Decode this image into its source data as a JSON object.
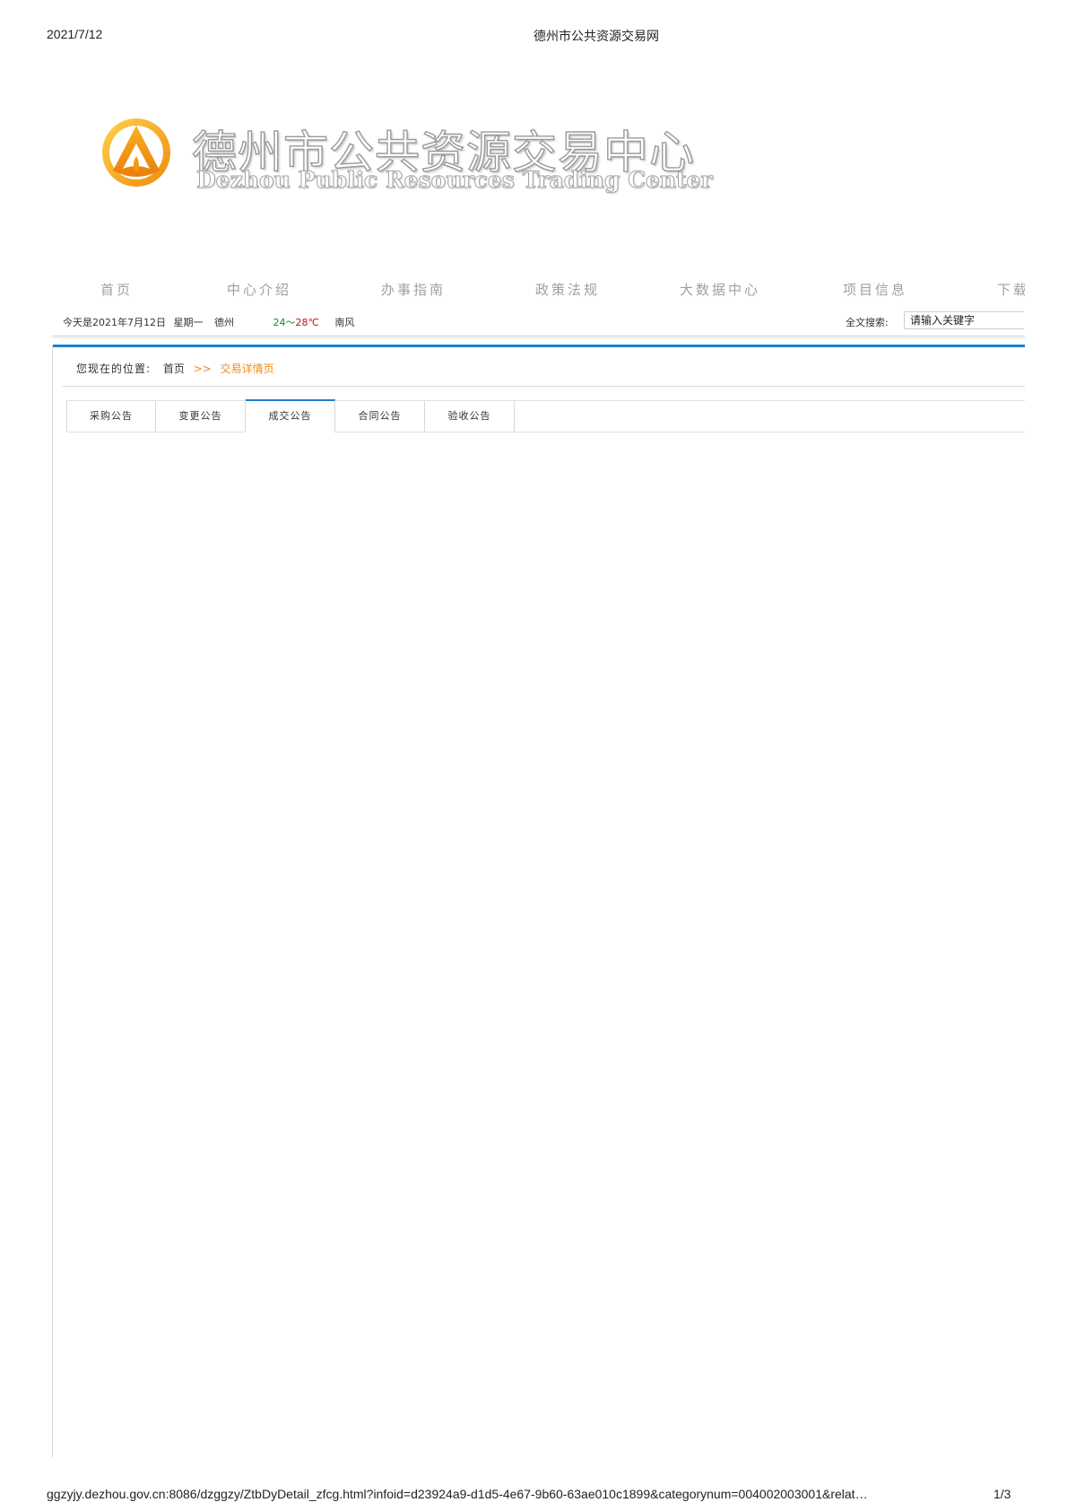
{
  "print": {
    "date": "2021/7/12",
    "title": "德州市公共资源交易网",
    "url": "ggzyjy.dezhou.gov.cn:8086/dzggzy/ZtbDyDetail_zfcg.html?infoid=d23924a9-d1d5-4e67-9b60-63ae010c1899&categorynum=004002003001&relat…",
    "page": "1/3"
  },
  "brand": {
    "name_cn": "德州市公共资源交易中心",
    "name_en": "Dezhou Public Resources Trading Center",
    "colors": {
      "logo_orange": "#f29a12",
      "logo_yellow": "#f8c32a"
    }
  },
  "nav": {
    "items": [
      "首页",
      "中心介绍",
      "办事指南",
      "政策法规",
      "大数据中心",
      "项目信息",
      "下载"
    ]
  },
  "info": {
    "today_label": "今天是",
    "date": "2021年7月12日",
    "weekday": "星期一",
    "city": "德州",
    "temp_low": "24",
    "temp_sep": "～",
    "temp_high": "28℃",
    "wind": "南风"
  },
  "search": {
    "label": "全文搜索:",
    "placeholder": "请输入关键字"
  },
  "breadcrumb": {
    "label": "您现在的位置:",
    "home": "首页",
    "separator": ">>",
    "current": "交易详情页"
  },
  "tabs": {
    "items": [
      "采购公告",
      "变更公告",
      "成交公告",
      "合同公告",
      "验收公告"
    ],
    "active_index": 2
  },
  "theme": {
    "accent": "#1e7fd0",
    "breadcrumb_current": "#f08c1c"
  }
}
